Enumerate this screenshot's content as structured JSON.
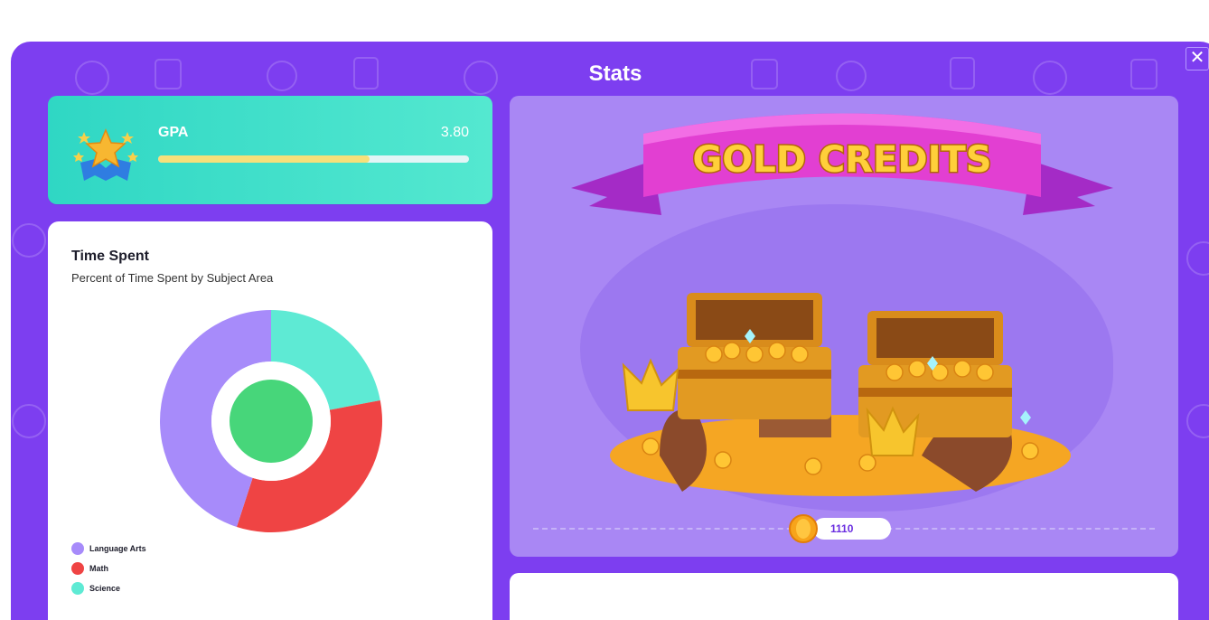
{
  "modal": {
    "title": "Stats",
    "close_label": "✕"
  },
  "gpa": {
    "label": "GPA",
    "value": "3.80",
    "progress_fraction": 0.68
  },
  "time_spent": {
    "title": "Time Spent",
    "subtitle": "Percent of Time Spent by Subject Area"
  },
  "chart_data": {
    "type": "pie",
    "title": "Time Spent",
    "subtitle": "Percent of Time Spent by Subject Area",
    "categories": [
      "Language Arts",
      "Math",
      "Science"
    ],
    "values": [
      45,
      33,
      22
    ],
    "colors": [
      "#a78bfa",
      "#ef4444",
      "#5eead4"
    ],
    "legend_position": "bottom-left"
  },
  "gold_credits": {
    "banner_text": "GOLD CREDITS",
    "amount": "1110"
  },
  "icons": {
    "close": "close-icon",
    "gpa": "stars-trophy-icon",
    "coin": "gold-coin-icon",
    "treasure": "treasure-chest-illustration"
  }
}
